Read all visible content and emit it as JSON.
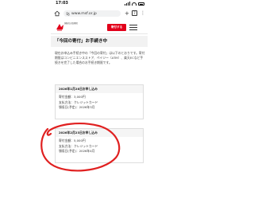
{
  "status_bar": {
    "time": "17:03"
  },
  "browser": {
    "url": "www.msf.or.jp",
    "tab_count": "7"
  },
  "header": {
    "logo_text": "国境なき医師団",
    "donate_label": "寄付する"
  },
  "page": {
    "title": "「今回の寄付」お手続き中",
    "intro": "現在お申込み手続き中の「今回の寄付」は以下のとおりです。寄付期限はコンビニエンスストア、ペイジー（ATM）、楽天ECなど手続きを完了した場合のお手続き期限です。"
  },
  "donations": [
    {
      "heading": "2026年1月28日お申し込み",
      "amount_label": "寄付金額：3,000円",
      "method_label": "支払方法：クレジットカード",
      "date_label": "領収日(予定)：2026年3月"
    },
    {
      "heading": "2026年2月23日お申し込み",
      "amount_label": "寄付金額：5,000円",
      "method_label": "支払方法：クレジットカード",
      "date_label": "領収日(予定)：2026年4月"
    }
  ],
  "colors": {
    "brand_red": "#e2001a",
    "annotation": "#e02020"
  }
}
